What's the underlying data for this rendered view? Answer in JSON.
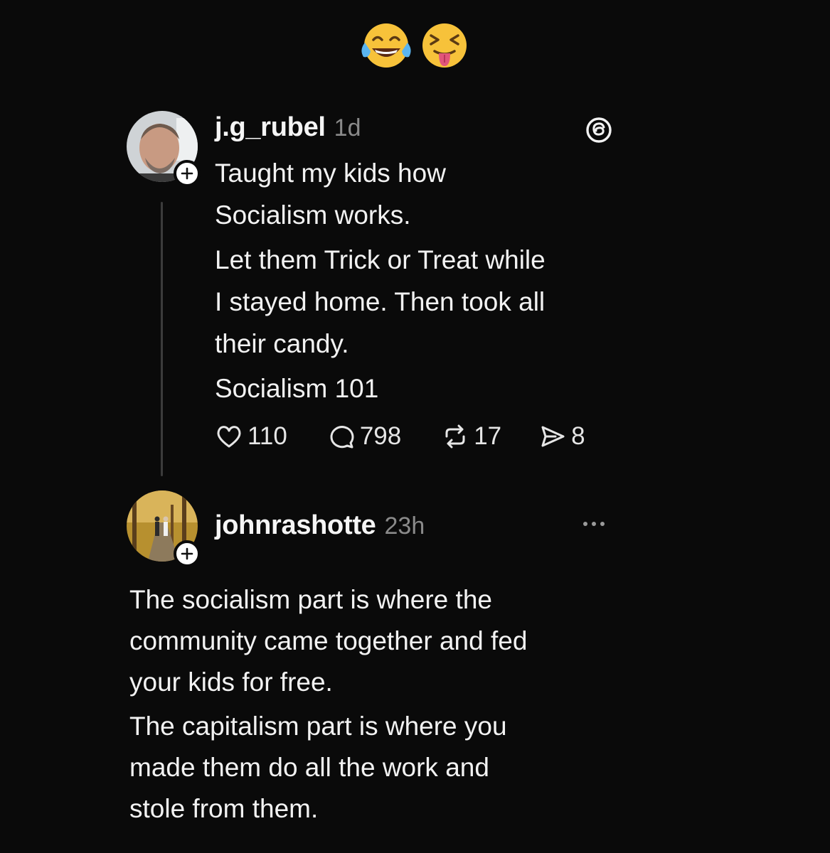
{
  "header": {
    "emojis": [
      "face-with-tears-of-joy",
      "squinting-face-with-tongue"
    ]
  },
  "post": {
    "username": "j.g_rubel",
    "time": "1d",
    "lines": [
      "Taught my kids how",
      "Socialism works.",
      "Let them Trick or Treat while",
      "I stayed home. Then took all",
      "their candy.",
      "Socialism 101"
    ],
    "metrics": {
      "likes": "110",
      "replies": "798",
      "reposts": "17",
      "shares": "8"
    },
    "logo_icon": "threads-icon"
  },
  "reply": {
    "username": "johnrashotte",
    "time": "23h",
    "lines": [
      "The socialism part is where the",
      "community came together and fed",
      "your kids for free.",
      "The capitalism part is where you",
      "made them do all the work and",
      "stole from them."
    ],
    "menu_icon": "more-options-icon"
  },
  "colors": {
    "background": "#0a0a0a",
    "text": "#f2f2f2",
    "muted": "#8a8a8a",
    "thread_line": "#3b3b3b"
  }
}
